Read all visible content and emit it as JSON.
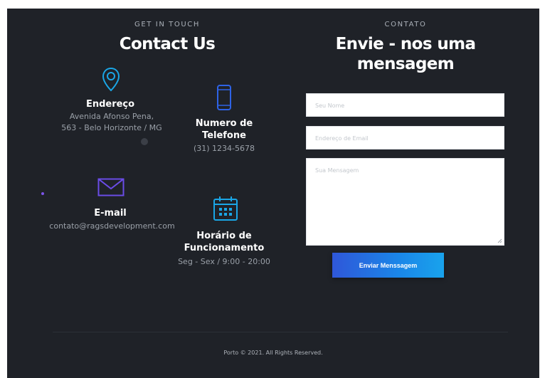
{
  "left_section": {
    "kicker": "GET IN TOUCH",
    "title": "Contact Us",
    "address": {
      "title": "Endereço",
      "lines": [
        "Avenida Afonso Pena,",
        "563 - Belo Horizonte / MG"
      ],
      "icon": "map-pin-icon"
    },
    "phone": {
      "title_lines": [
        "Numero de",
        "Telefone"
      ],
      "value": "(31) 1234-5678",
      "icon": "smartphone-icon"
    },
    "email": {
      "title": "E-mail",
      "value": "contato@ragsdevelopment.com",
      "icon": "envelope-icon"
    },
    "hours": {
      "title_lines": [
        "Horário de",
        "Funcionamento"
      ],
      "value": "Seg - Sex / 9:00 - 20:00",
      "icon": "calendar-icon"
    }
  },
  "right_section": {
    "kicker": "CONTATO",
    "title_lines": [
      "Envie - nos uma",
      "mensagem"
    ],
    "form": {
      "name_placeholder": "Seu Nome",
      "email_placeholder": "Endereço de Email",
      "message_placeholder": "Sua Mensagem",
      "submit_label": "Enviar Menssagem"
    }
  },
  "footer": {
    "text": "Porto © 2021. All Rights Reserved."
  },
  "colors": {
    "background": "#1f2228",
    "icon_cyan": "#1aa6e6",
    "icon_blue": "#2e63e6",
    "icon_purple": "#6a4ce6",
    "button_start": "#2f57d9",
    "button_end": "#19a3ec"
  }
}
